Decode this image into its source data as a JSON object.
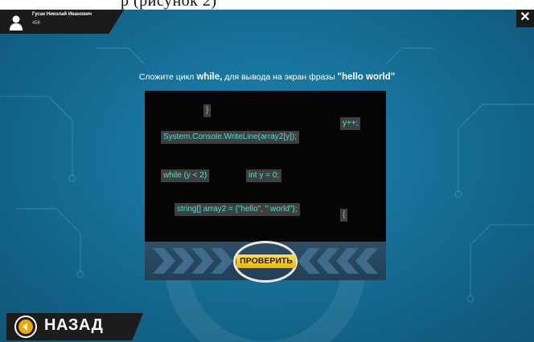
{
  "user": {
    "name": "Гусак Николай Иванович",
    "score": "456"
  },
  "close": {
    "label": "✕"
  },
  "task": {
    "prefix": "Сложите цикл ",
    "keyword": "while,",
    "middle": " для вывода на экран фразы ",
    "phrase": "\"hello world\""
  },
  "code_blocks": {
    "close_brace": "}",
    "increment": "y++;",
    "writeline": "System.Console.WriteLine(array2[y]);",
    "while_cond": "while (y < 2)",
    "init": "int y = 0;",
    "array_decl": "string[] array2 = {\"hello\", \" world\"};",
    "open_brace": "{"
  },
  "check_button": {
    "label": "ПРОВЕРИТЬ"
  },
  "back_button": {
    "label": "НАЗАД"
  },
  "colors": {
    "background": "#1a78a3",
    "code_text": "#49e2d8",
    "check_button": "#f5c400"
  },
  "icons": {
    "avatar": "user-silhouette-icon",
    "close": "close-icon",
    "back": "back-arrow-icon"
  }
}
